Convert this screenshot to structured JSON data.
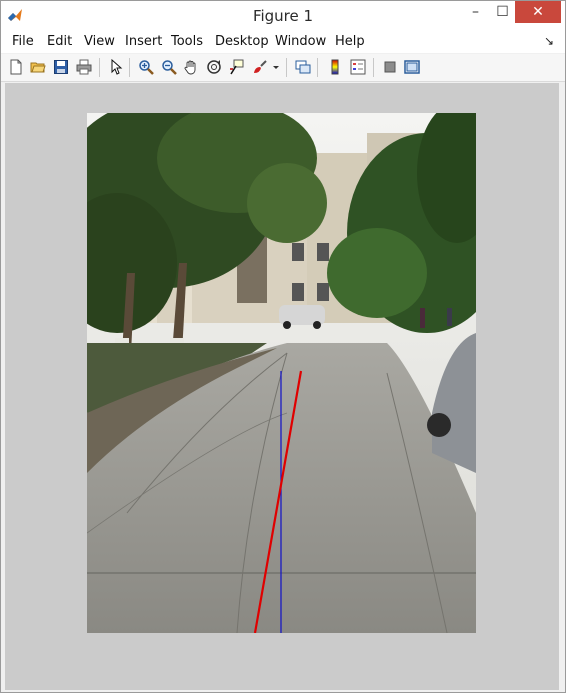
{
  "window": {
    "title": "Figure 1",
    "minimize_glyph": "–",
    "maximize_glyph": "☐",
    "close_glyph": "✕"
  },
  "menu": {
    "items": [
      "File",
      "Edit",
      "View",
      "Insert",
      "Tools",
      "Desktop",
      "Window",
      "Help"
    ],
    "overflow_glyph": "↘"
  },
  "toolbar": {
    "icons": [
      "new-figure-icon",
      "open-file-icon",
      "save-icon",
      "print-icon",
      "pointer-icon",
      "zoom-in-icon",
      "zoom-out-icon",
      "pan-hand-icon",
      "rotate-3d-icon",
      "data-cursor-icon",
      "brush-icon",
      "dropdown-icon",
      "link-plot-icon",
      "colorbar-icon",
      "legend-icon",
      "hide-plot-tools-icon",
      "show-plot-tools-icon"
    ]
  },
  "plot": {
    "image_description_hidden": "",
    "line_colors": {
      "red_line": "#e00000",
      "blue_line": "#1010c8"
    }
  },
  "colors": {
    "figure_background": "#cbcbcb",
    "close_button": "#c9483c"
  }
}
